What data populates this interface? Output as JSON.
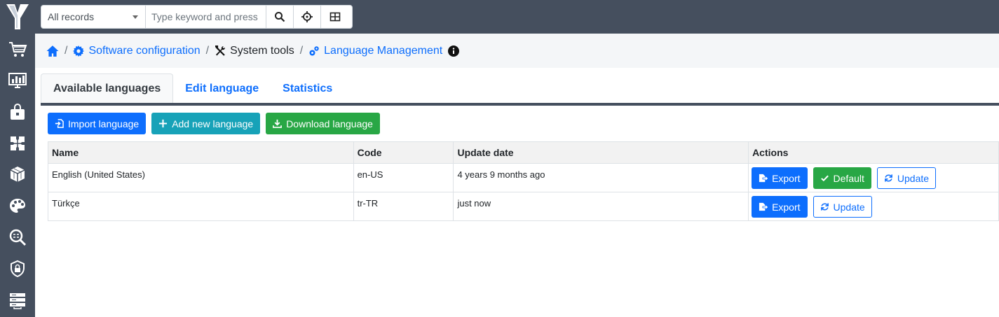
{
  "colors": {
    "sidebar": "#454f5e",
    "primary": "#0d6efd",
    "success": "#28a745",
    "info": "#17a2b8"
  },
  "sidebar": {
    "items": [
      {
        "icon": "cart-icon"
      },
      {
        "icon": "monitor-chart-icon"
      },
      {
        "icon": "bag-icon"
      },
      {
        "icon": "puzzle-icon"
      },
      {
        "icon": "cube-icon"
      },
      {
        "icon": "palette-icon"
      },
      {
        "icon": "search-inspect-icon"
      },
      {
        "icon": "shield-icon"
      },
      {
        "icon": "server-icon"
      }
    ]
  },
  "search": {
    "scope": "All records",
    "placeholder": "Type keyword and press e",
    "value": ""
  },
  "breadcrumb": {
    "software_configuration": "Software configuration",
    "system_tools": "System tools",
    "language_management": "Language Management",
    "separator": "/"
  },
  "tabs": [
    {
      "label": "Available languages",
      "active": true
    },
    {
      "label": "Edit language",
      "active": false
    },
    {
      "label": "Statistics",
      "active": false
    }
  ],
  "toolbar": {
    "import_label": "Import language",
    "add_label": "Add new language",
    "download_label": "Download language"
  },
  "table": {
    "columns": [
      "Name",
      "Code",
      "Update date",
      "Actions"
    ],
    "rows": [
      {
        "name": "English (United States)",
        "code": "en-US",
        "updated": "4 years 9 months ago",
        "export": "Export",
        "default": "Default",
        "update": "Update"
      },
      {
        "name": "Türkçe",
        "code": "tr-TR",
        "updated": "just now",
        "export": "Export",
        "update": "Update"
      }
    ]
  }
}
